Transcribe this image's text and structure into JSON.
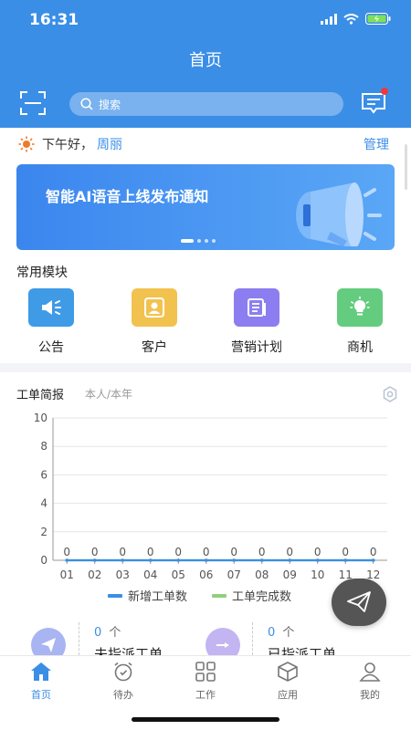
{
  "status_bar": {
    "time": "16:31"
  },
  "header": {
    "title": "首页",
    "search_placeholder": "搜索"
  },
  "greeting": {
    "text": "下午好，",
    "name": "周丽",
    "manage": "管理"
  },
  "banner": {
    "text": "智能AI语音上线发布通知"
  },
  "modules": {
    "title": "常用模块",
    "items": [
      {
        "label": "公告",
        "color": "#3f9be6",
        "icon": "megaphone-icon"
      },
      {
        "label": "客户",
        "color": "#f2c24f",
        "icon": "person-icon"
      },
      {
        "label": "营销计划",
        "color": "#8c7ef0",
        "icon": "document-icon"
      },
      {
        "label": "商机",
        "color": "#63cc7f",
        "icon": "lightbulb-icon"
      }
    ]
  },
  "report": {
    "title": "工单简报",
    "subtitle": "本人/本年"
  },
  "chart_data": {
    "type": "line",
    "categories": [
      "01",
      "02",
      "03",
      "04",
      "05",
      "06",
      "07",
      "08",
      "09",
      "10",
      "11",
      "12"
    ],
    "ylim": [
      0,
      10
    ],
    "yticks": [
      0,
      2,
      4,
      6,
      8,
      10
    ],
    "series": [
      {
        "name": "新增工单数",
        "color": "#3a8ee6",
        "values": [
          0,
          0,
          0,
          0,
          0,
          0,
          0,
          0,
          0,
          0,
          0,
          0
        ]
      },
      {
        "name": "工单完成数",
        "color": "#8fd07a",
        "values": [
          0,
          0,
          0,
          0,
          0,
          0,
          0,
          0,
          0,
          0,
          0,
          0
        ]
      }
    ],
    "grid": true,
    "legend": "bottom"
  },
  "stats": [
    {
      "count": "0",
      "unit": "个",
      "label": "未指派工单",
      "color": "#a9b4f2"
    },
    {
      "count": "0",
      "unit": "个",
      "label": "已指派工单",
      "color": "#c3b5f2"
    }
  ],
  "tabbar": {
    "items": [
      {
        "label": "首页",
        "icon": "home-icon",
        "active": true
      },
      {
        "label": "待办",
        "icon": "alarm-clock-icon",
        "active": false
      },
      {
        "label": "工作",
        "icon": "grid-icon",
        "active": false
      },
      {
        "label": "应用",
        "icon": "box-icon",
        "active": false
      },
      {
        "label": "我的",
        "icon": "user-icon",
        "active": false
      }
    ]
  }
}
